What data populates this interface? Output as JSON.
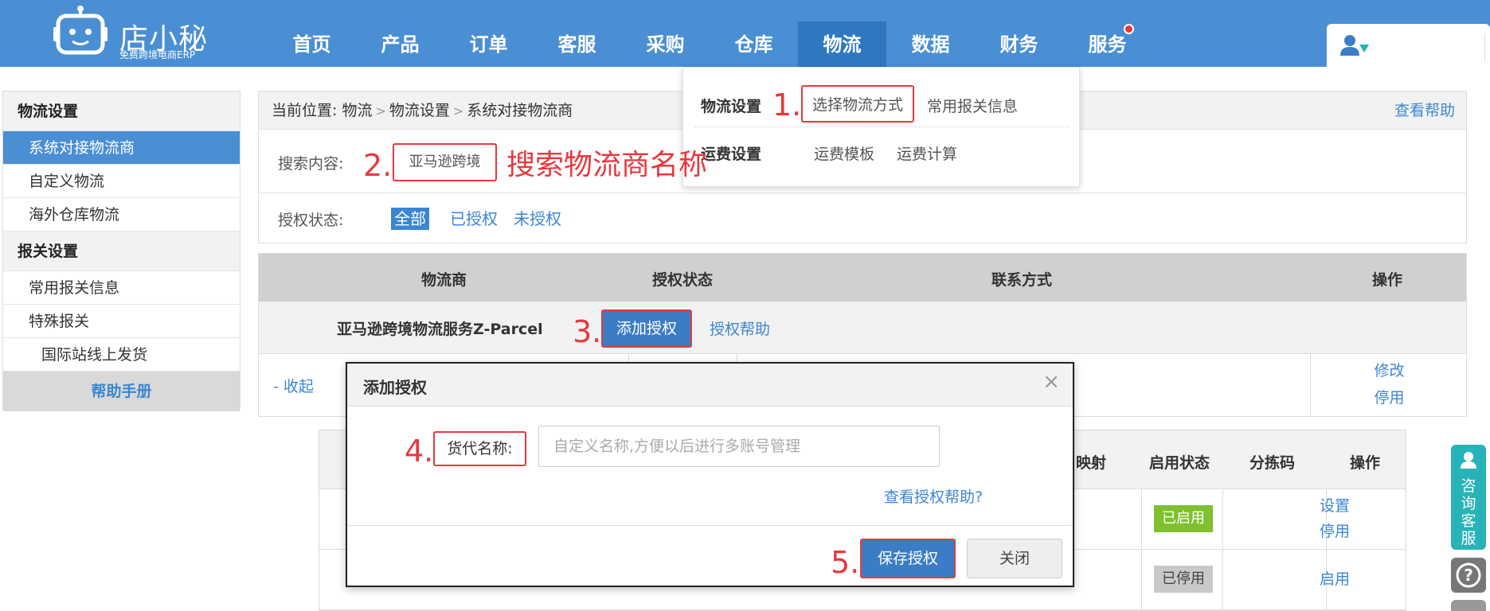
{
  "brand": {
    "name": "店小秘",
    "tagline": "免费跨境电商ERP"
  },
  "nav": {
    "items": [
      {
        "label": "首页"
      },
      {
        "label": "产品"
      },
      {
        "label": "订单"
      },
      {
        "label": "客服"
      },
      {
        "label": "采购"
      },
      {
        "label": "仓库"
      },
      {
        "label": "物流"
      },
      {
        "label": "数据"
      },
      {
        "label": "财务"
      },
      {
        "label": "服务"
      }
    ],
    "active": "物流"
  },
  "sidebar": {
    "group1": "物流设置",
    "items1": [
      {
        "label": "系统对接物流商"
      },
      {
        "label": "自定义物流"
      },
      {
        "label": "海外仓库物流"
      }
    ],
    "group2": "报关设置",
    "items2": [
      {
        "label": "常用报关信息"
      },
      {
        "label": "特殊报关"
      },
      {
        "label": "国际站线上发货"
      }
    ],
    "help": "帮助手册"
  },
  "breadcrumb": {
    "prefix": "当前位置:",
    "parts": [
      "物流",
      "物流设置",
      "系统对接物流商"
    ],
    "help": "查看帮助"
  },
  "search": {
    "label": "搜索内容:",
    "value": "亚马逊跨境"
  },
  "auth_filter": {
    "label": "授权状态:",
    "options": [
      "全部",
      "已授权",
      "未授权"
    ]
  },
  "table": {
    "headers": [
      "物流商",
      "授权状态",
      "联系方式",
      "操作"
    ],
    "carrier": "亚马逊跨境物流服务Z-Parcel",
    "add_auth": "添加授权",
    "auth_help": "授权帮助",
    "collapse": "- 收起",
    "row_actions": [
      "修改",
      "停用"
    ]
  },
  "lower_table": {
    "headers": [
      "映射",
      "启用状态",
      "分拣码",
      "操作"
    ],
    "rows": [
      {
        "status": "已启用",
        "actions": [
          "设置",
          "停用"
        ]
      },
      {
        "status": "已停用",
        "actions": [
          "启用"
        ]
      }
    ]
  },
  "dropdown": {
    "group1": "物流设置",
    "group1_links": [
      "选择物流方式",
      "常用报关信息"
    ],
    "group2": "运费设置",
    "group2_links": [
      "运费模板",
      "运费计算"
    ]
  },
  "modal": {
    "title": "添加授权",
    "close": "×",
    "field_label": "货代名称:",
    "field_placeholder": "自定义名称,方便以后进行多账号管理",
    "help_link": "查看授权帮助?",
    "save": "保存授权",
    "cancel": "关闭"
  },
  "annotations": {
    "n1": "1.",
    "n2": "2.",
    "n3": "3.",
    "n4": "4.",
    "n5": "5.",
    "search_hint": "搜索物流商名称"
  },
  "float": {
    "service": "咨询客服",
    "help_icon": "question-icon"
  },
  "colors": {
    "primary": "#4a8fd3",
    "highlight": "#e8383d",
    "enabled": "#7fc02f",
    "teal": "#27b3b8"
  }
}
